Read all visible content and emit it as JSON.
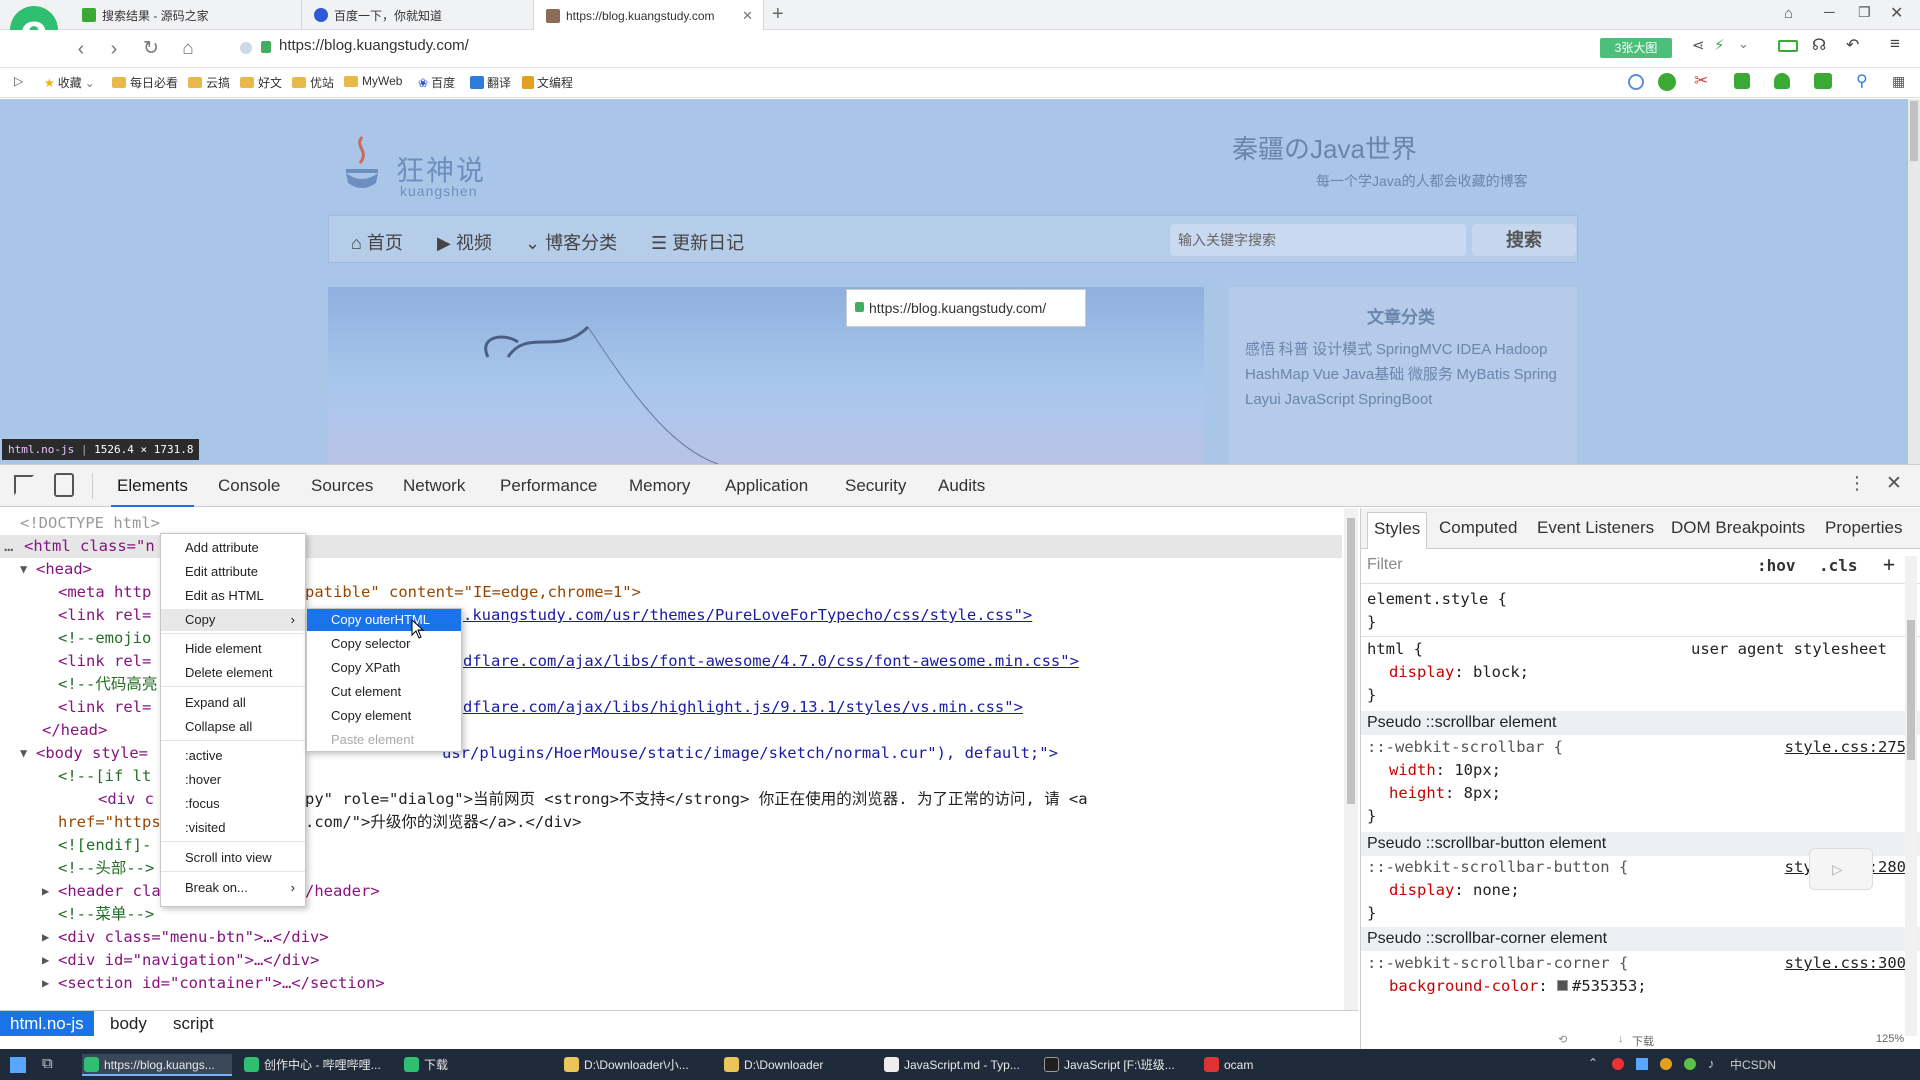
{
  "browser": {
    "tabs": [
      {
        "title": "搜索结果 - 源码之家",
        "active": false
      },
      {
        "title": "百度一下，你就知道",
        "active": false
      },
      {
        "title": "https://blog.kuangstudy.com",
        "active": true
      }
    ],
    "new_tab_symbol": "+",
    "url": "https://blog.kuangstudy.com/",
    "promo_badge": "3张大图",
    "bookmarks": [
      "收藏",
      "每日必看",
      "云搞",
      "好文",
      "优站",
      "MyWeb",
      "百度",
      "翻译",
      "文编程"
    ]
  },
  "site": {
    "logo_text": "狂神说",
    "logo_sub": "kuangshen",
    "title": "秦疆のJava世界",
    "subtitle": "每一个学Java的人都会收藏的博客",
    "nav": [
      "首页",
      "视频",
      "博客分类",
      "更新日记"
    ],
    "search_placeholder": "输入关键字搜索",
    "search_button": "搜索",
    "aside_title": "文章分类",
    "aside_tags": [
      "感悟",
      "科普",
      "设计模式",
      "SpringMVC",
      "IDEA",
      "Hadoop",
      "HashMap",
      "Vue",
      "Java基础",
      "微服务",
      "MyBatis",
      "Spring",
      "Layui",
      "JavaScript",
      "SpringBoot"
    ],
    "link_tooltip": "https://blog.kuangstudy.com/",
    "element_hint_tag": "html.no-js",
    "element_hint_size": "1526.4 × 1731.8"
  },
  "devtools": {
    "tabs": [
      "Elements",
      "Console",
      "Sources",
      "Network",
      "Performance",
      "Memory",
      "Application",
      "Security",
      "Audits"
    ],
    "active_tab": "Elements",
    "code_lines": [
      "<!DOCTYPE html>",
      "<html class=\"n",
      "<head>",
      "<meta http",
      "patible\" content=\"IE=edge,chrome=1\">",
      "<link rel=",
      ".kuangstudy.com/usr/themes/PureLoveForTypecho/css/style.css\">",
      "<!--emojio",
      "<link rel=",
      "dflare.com/ajax/libs/font-awesome/4.7.0/css/font-awesome.min.css\">",
      "<!--代码高亮",
      "<link rel=",
      "dflare.com/ajax/libs/highlight.js/9.13.1/styles/vs.min.css\">",
      "</head>",
      "<body style=",
      "usr/plugins/HoerMouse/static/image/sketch/normal.cur\"), default;\">",
      "<!--[if lt",
      "<div c",
      "py\" role=\"dialog\">当前网页 <strong>不支持</strong> 你正在使用的浏览器. 为了正常的访问, 请 <a",
      "href=\"https",
      ".com/\">升级你的浏览器</a>.</div>",
      "<![endif]-",
      "<!--头部-->",
      "<header cla",
      "/header>",
      "<!--菜单-->",
      "<div class=\"menu-btn\">…</div>",
      "<div id=\"navigation\">…</div>",
      "<section id=\"container\">…</section>"
    ],
    "breadcrumbs": [
      "html.no-js",
      "body",
      "script"
    ],
    "styles_tabs": [
      "Styles",
      "Computed",
      "Event Listeners",
      "DOM Breakpoints",
      "Properties"
    ],
    "filter_placeholder": "Filter",
    "hov": ":hov",
    "cls": ".cls",
    "plus": "+",
    "rules": {
      "element_style": "element.style {",
      "close": "}",
      "html_selector": "html {",
      "html_source": "user agent stylesheet",
      "display_prop": "display",
      "block_val": "block;",
      "pseudo1": "Pseudo ::scrollbar element",
      "sel1": "::-webkit-scrollbar {",
      "src1": "style.css:275",
      "width_prop": "width",
      "width_val": "10px;",
      "height_prop": "height",
      "height_val": "8px;",
      "pseudo2": "Pseudo ::scrollbar-button element",
      "sel2": "::-webkit-scrollbar-button {",
      "src2": "style.css:280",
      "none_val": "none;",
      "pseudo3": "Pseudo ::scrollbar-corner element",
      "sel3": "::-webkit-scrollbar-corner {",
      "src3": "style.css:300",
      "bg_prop": "background-color",
      "bg_val": "#535353;"
    }
  },
  "context_menu": {
    "items": [
      "Add attribute",
      "Edit attribute",
      "Edit as HTML",
      "Copy",
      "Hide element",
      "Delete element",
      "Expand all",
      "Collapse all",
      ":active",
      ":hover",
      ":focus",
      ":visited",
      "Scroll into view",
      "Break on..."
    ],
    "submenu": [
      "Copy outerHTML",
      "Copy selector",
      "Copy XPath",
      "Cut element",
      "Copy element",
      "Paste element"
    ]
  },
  "taskbar": {
    "items": [
      "https://blog.kuangs...",
      "创作中心 - 哔哩哔哩...",
      "下载",
      "D:\\Downloader\\小...",
      "D:\\Downloader",
      "JavaScript.md - Typ...",
      "JavaScript [F:\\班级...",
      "ocam"
    ],
    "tray_text": "中CSDN",
    "zoom": "125%",
    "download_label": "下载"
  },
  "colors": {
    "accent": "#1a73e8",
    "page_overlay": "#a9c6e8",
    "logo": "#2fbf71"
  }
}
